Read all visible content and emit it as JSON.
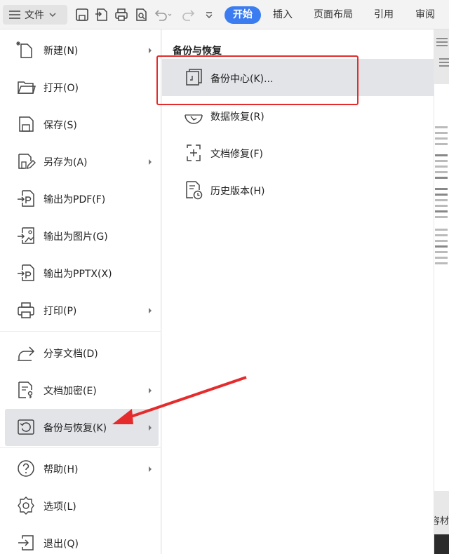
{
  "toolbar": {
    "file_label": "文件",
    "tabs": [
      "开始",
      "插入",
      "页面布局",
      "引用",
      "审阅"
    ]
  },
  "menu": {
    "items": [
      {
        "label": "新建(N)",
        "icon": "new-file-icon",
        "has_submenu": true
      },
      {
        "label": "打开(O)",
        "icon": "folder-open-icon",
        "has_submenu": false
      },
      {
        "label": "保存(S)",
        "icon": "save-icon",
        "has_submenu": false
      },
      {
        "label": "另存为(A)",
        "icon": "save-as-icon",
        "has_submenu": true
      },
      {
        "label": "输出为PDF(F)",
        "icon": "export-pdf-icon",
        "has_submenu": false
      },
      {
        "label": "输出为图片(G)",
        "icon": "export-image-icon",
        "has_submenu": false
      },
      {
        "label": "输出为PPTX(X)",
        "icon": "export-pptx-icon",
        "has_submenu": false
      },
      {
        "label": "打印(P)",
        "icon": "print-icon",
        "has_submenu": true
      },
      {
        "label": "分享文档(D)",
        "icon": "share-icon",
        "has_submenu": false
      },
      {
        "label": "文档加密(E)",
        "icon": "encrypt-icon",
        "has_submenu": true
      },
      {
        "label": "备份与恢复(K)",
        "icon": "backup-restore-icon",
        "has_submenu": true,
        "selected": true
      },
      {
        "label": "帮助(H)",
        "icon": "help-icon",
        "has_submenu": true
      },
      {
        "label": "选项(L)",
        "icon": "settings-gear-icon",
        "has_submenu": false
      },
      {
        "label": "退出(Q)",
        "icon": "exit-icon",
        "has_submenu": false
      }
    ]
  },
  "submenu": {
    "title": "备份与恢复",
    "items": [
      {
        "label": "备份中心(K)...",
        "icon": "backup-center-icon",
        "highlighted": true
      },
      {
        "label": "数据恢复(R)",
        "icon": "data-recovery-icon"
      },
      {
        "label": "文档修复(F)",
        "icon": "document-repair-icon"
      },
      {
        "label": "历史版本(H)",
        "icon": "history-version-icon"
      }
    ]
  },
  "document": {
    "corner_text": "容材"
  },
  "colors": {
    "accent": "#3b7df0",
    "annotation": "#e52b2b",
    "selected_bg": "#e2e4e8"
  }
}
